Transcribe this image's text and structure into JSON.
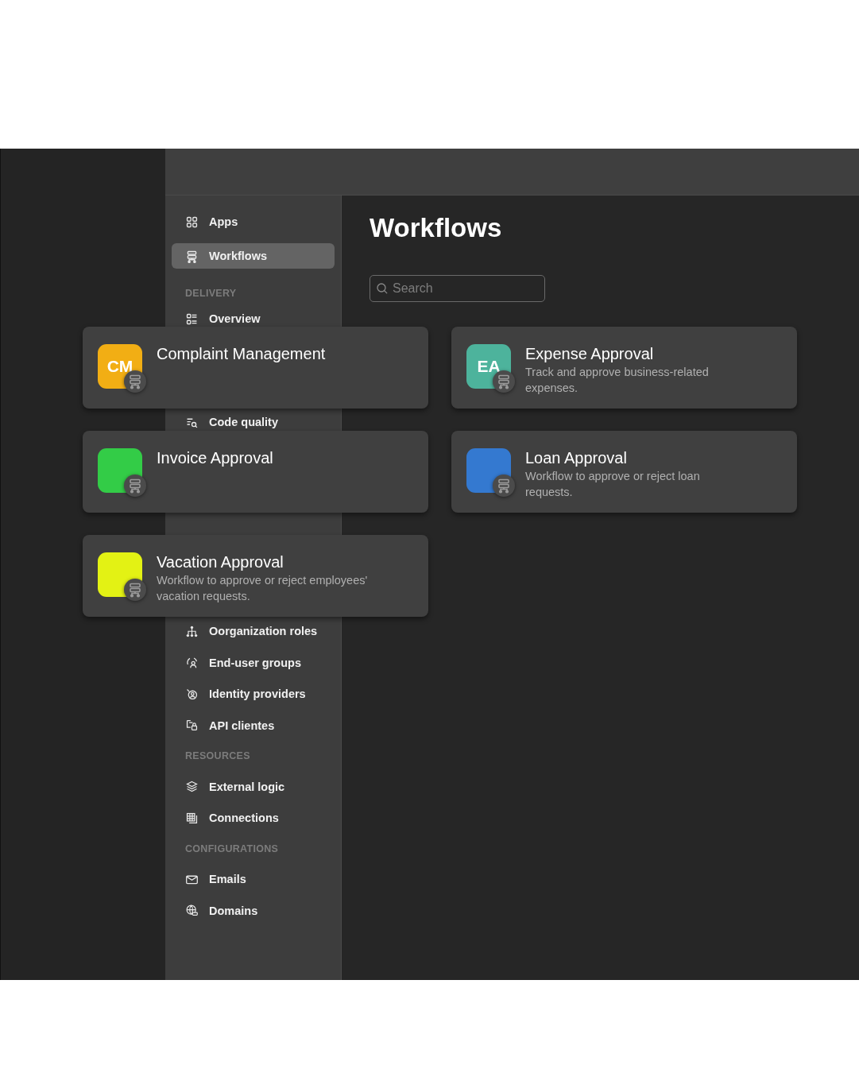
{
  "page": {
    "title": "Workflows"
  },
  "search": {
    "placeholder": "Search"
  },
  "sidebar": {
    "groups": [
      {
        "items": [
          {
            "kind": "link",
            "label": "Apps",
            "selected": false
          },
          {
            "kind": "link",
            "label": "Workflows",
            "selected": true
          },
          {
            "kind": "section",
            "label": "DELIVERY"
          },
          {
            "kind": "link",
            "label": "Overview",
            "selected": false
          },
          {
            "kind": "link",
            "label": "Code quality",
            "selected": false
          }
        ]
      },
      {
        "items": [
          {
            "kind": "link",
            "label": "Oorganization roles",
            "selected": false
          },
          {
            "kind": "link",
            "label": "End-user groups",
            "selected": false
          },
          {
            "kind": "link",
            "label": "Identity providers",
            "selected": false
          },
          {
            "kind": "link",
            "label": "API clientes",
            "selected": false
          },
          {
            "kind": "section",
            "label": "RESOURCES"
          },
          {
            "kind": "link",
            "label": "External logic",
            "selected": false
          },
          {
            "kind": "link",
            "label": "Connections",
            "selected": false
          },
          {
            "kind": "section",
            "label": "CONFIGURATIONS"
          },
          {
            "kind": "link",
            "label": "Emails",
            "selected": false
          },
          {
            "kind": "link",
            "label": "Domains",
            "selected": false
          }
        ]
      }
    ]
  },
  "workflows": [
    {
      "title": "Complaint Management",
      "initials": "CM",
      "color": "#f2ae14"
    },
    {
      "title": "Expense Approval",
      "initials": "EA",
      "color": "#4db39c",
      "description": "Track and approve business-related expenses."
    },
    {
      "title": "Invoice Approval",
      "color": "#33cc47"
    },
    {
      "title": "Loan Approval",
      "color": "#3479d0",
      "description": "Workflow to approve or reject loan requests."
    },
    {
      "title": "Vacation Approval",
      "color": "#e3f214",
      "description": "Workflow to approve or reject employees' vacation requests."
    }
  ]
}
